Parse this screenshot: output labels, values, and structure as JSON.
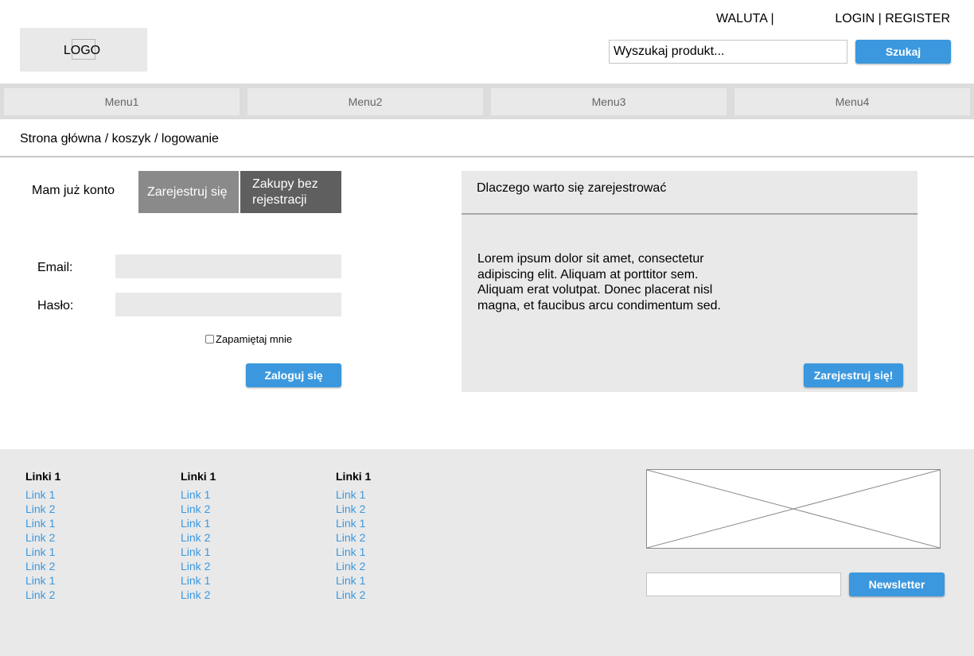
{
  "header": {
    "logo_label": "LOGO",
    "currency_label": "WALUTA |",
    "auth_label": "LOGIN | REGISTER",
    "search": {
      "value": "Wyszukaj produkt...",
      "button_label": "Szukaj"
    }
  },
  "menu": [
    "Menu1",
    "Menu2",
    "Menu3",
    "Menu4"
  ],
  "breadcrumb": "Strona główna / koszyk / logowanie",
  "tabs": {
    "have_account": "Mam już konto",
    "register": "Zarejestruj się",
    "guest": "Zakupy bez rejestracji"
  },
  "login_form": {
    "email_label": "Email:",
    "password_label": "Hasło:",
    "remember_label": "Zapamiętaj mnie",
    "submit_label": "Zaloguj się"
  },
  "why_register": {
    "title": "Dlaczego warto się zarejestrować",
    "text": "Lorem ipsum dolor sit amet, consectetur adipiscing elit. Aliquam at porttitor sem. Aliquam erat volutpat. Donec placerat nisl magna, et faucibus arcu condimentum sed.",
    "button_label": "Zarejestruj się!"
  },
  "footer": {
    "columns": [
      {
        "heading": "Linki 1",
        "links": [
          "Link 1",
          "Link 2",
          "Link 1",
          "Link 2",
          "Link 1",
          "Link 2",
          "Link 1",
          "Link 2"
        ]
      },
      {
        "heading": "Linki 1",
        "links": [
          "Link 1",
          "Link 2",
          "Link 1",
          "Link 2",
          "Link 1",
          "Link 2",
          "Link 1",
          "Link 2"
        ]
      },
      {
        "heading": "Linki 1",
        "links": [
          "Link 1",
          "Link 2",
          "Link 1",
          "Link 2",
          "Link 1",
          "Link 2",
          "Link 1",
          "Link 2"
        ]
      }
    ],
    "newsletter_button_label": "Newsletter"
  },
  "colors": {
    "accent": "#3b98de",
    "panel_bg": "#e9e9e9",
    "tab_register_bg": "#8a8a8a",
    "tab_guest_bg": "#5f5f5f"
  }
}
